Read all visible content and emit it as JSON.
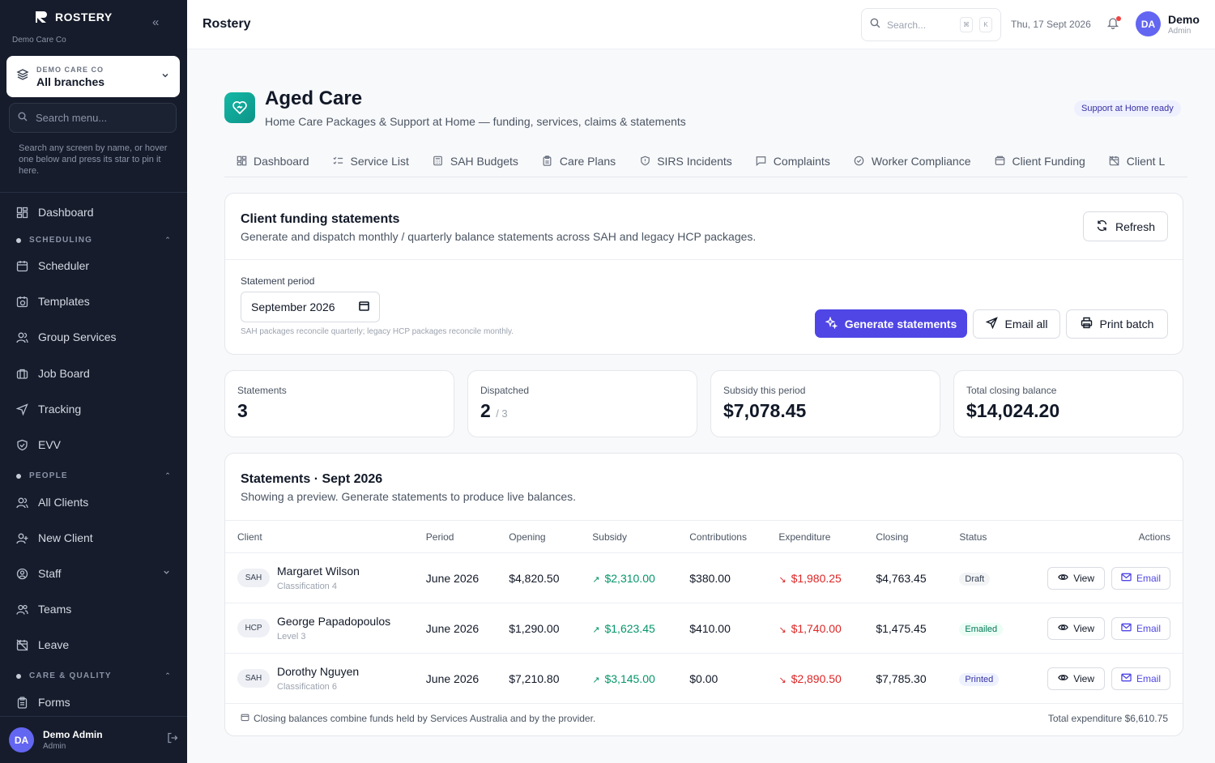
{
  "colors": {
    "accent": "#4f46e5",
    "sidebar_bg": "#161c2b",
    "teal": "#14b8a6",
    "positive": "#059669",
    "negative": "#dc2626"
  },
  "sidebar": {
    "brand": "ROSTERY",
    "org": "Demo Care Co",
    "branch_label": "DEMO CARE CO",
    "branch_value": "All branches",
    "search_placeholder": "Search menu...",
    "hint": "Search any screen by name, or hover one below and press its star to pin it here.",
    "items": [
      {
        "label": "Dashboard",
        "icon": "grid-icon"
      },
      {
        "label": "Scheduler",
        "icon": "calendar-icon"
      },
      {
        "label": "Templates",
        "icon": "calendar-clock-icon"
      },
      {
        "label": "Group Services",
        "icon": "users-icon"
      },
      {
        "label": "Job Board",
        "icon": "briefcase-icon"
      },
      {
        "label": "Tracking",
        "icon": "navigation-icon"
      },
      {
        "label": "EVV",
        "icon": "shield-check-icon"
      },
      {
        "label": "All Clients",
        "icon": "users-icon"
      },
      {
        "label": "New Client",
        "icon": "user-plus-icon"
      },
      {
        "label": "Staff",
        "icon": "user-circle-icon"
      },
      {
        "label": "Teams",
        "icon": "team-icon"
      },
      {
        "label": "Leave",
        "icon": "calendar-off-icon"
      },
      {
        "label": "Forms",
        "icon": "clipboard-icon"
      }
    ],
    "sections": [
      "SCHEDULING",
      "PEOPLE",
      "CARE & QUALITY"
    ],
    "user_initials": "DA",
    "user_name": "Demo Admin",
    "user_role": "Admin"
  },
  "topbar": {
    "title": "Rostery",
    "search_placeholder": "Search...",
    "kbd_cmd": "⌘",
    "kbd_k": "K",
    "date": "Thu, 17 Sept 2026",
    "user_initials": "DA",
    "user_name": "Demo",
    "user_role": "Admin"
  },
  "page": {
    "title": "Aged Care",
    "subtitle": "Home Care Packages & Support at Home — funding, services, claims & statements",
    "badge": "Support at Home ready",
    "tabs": [
      {
        "label": "Dashboard",
        "icon": "grid-icon"
      },
      {
        "label": "Service List",
        "icon": "list-check-icon"
      },
      {
        "label": "SAH Budgets",
        "icon": "calculator-icon"
      },
      {
        "label": "Care Plans",
        "icon": "clipboard-icon"
      },
      {
        "label": "SIRS Incidents",
        "icon": "shield-icon"
      },
      {
        "label": "Complaints",
        "icon": "message-icon"
      },
      {
        "label": "Worker Compliance",
        "icon": "check-circle-icon"
      },
      {
        "label": "Client Funding",
        "icon": "wallet-icon"
      },
      {
        "label": "Client L",
        "icon": "calendar-off-icon"
      }
    ]
  },
  "funding": {
    "title": "Client funding statements",
    "subtitle": "Generate and dispatch monthly / quarterly balance statements across SAH and legacy HCP packages.",
    "refresh_label": "Refresh",
    "period_label": "Statement period",
    "period_value": "September 2026",
    "period_hint": "SAH packages reconcile quarterly; legacy HCP packages reconcile monthly.",
    "generate_label": "Generate statements",
    "email_all_label": "Email all",
    "print_label": "Print batch"
  },
  "stats": [
    {
      "label": "Statements",
      "value": "3",
      "suffix": ""
    },
    {
      "label": "Dispatched",
      "value": "2",
      "suffix": "/ 3"
    },
    {
      "label": "Subsidy this period",
      "value": "$7,078.45",
      "suffix": ""
    },
    {
      "label": "Total closing balance",
      "value": "$14,024.20",
      "suffix": ""
    }
  ],
  "statements": {
    "title": "Statements · Sept 2026",
    "subtitle": "Showing a preview. Generate statements to produce live balances.",
    "columns": [
      "Client",
      "Period",
      "Opening",
      "Subsidy",
      "Contributions",
      "Expenditure",
      "Closing",
      "Status",
      "Actions"
    ],
    "rows": [
      {
        "package": "SAH",
        "name": "Margaret Wilson",
        "classification": "Classification 4",
        "period": "June 2026",
        "opening": "$4,820.50",
        "subsidy": "$2,310.00",
        "contributions": "$380.00",
        "expenditure": "$1,980.25",
        "closing": "$4,763.45",
        "status": "Draft",
        "status_kind": "draft"
      },
      {
        "package": "HCP",
        "name": "George Papadopoulos",
        "classification": "Level 3",
        "period": "June 2026",
        "opening": "$1,290.00",
        "subsidy": "$1,623.45",
        "contributions": "$410.00",
        "expenditure": "$1,740.00",
        "closing": "$1,475.45",
        "status": "Emailed",
        "status_kind": "emailed"
      },
      {
        "package": "SAH",
        "name": "Dorothy Nguyen",
        "classification": "Classification 6",
        "period": "June 2026",
        "opening": "$7,210.80",
        "subsidy": "$3,145.00",
        "contributions": "$0.00",
        "expenditure": "$2,890.50",
        "closing": "$7,785.30",
        "status": "Printed",
        "status_kind": "printed"
      }
    ],
    "view_label": "View",
    "email_label": "Email",
    "footer_note": "Closing balances combine funds held by Services Australia and by the provider.",
    "footer_total": "Total expenditure $6,610.75"
  }
}
